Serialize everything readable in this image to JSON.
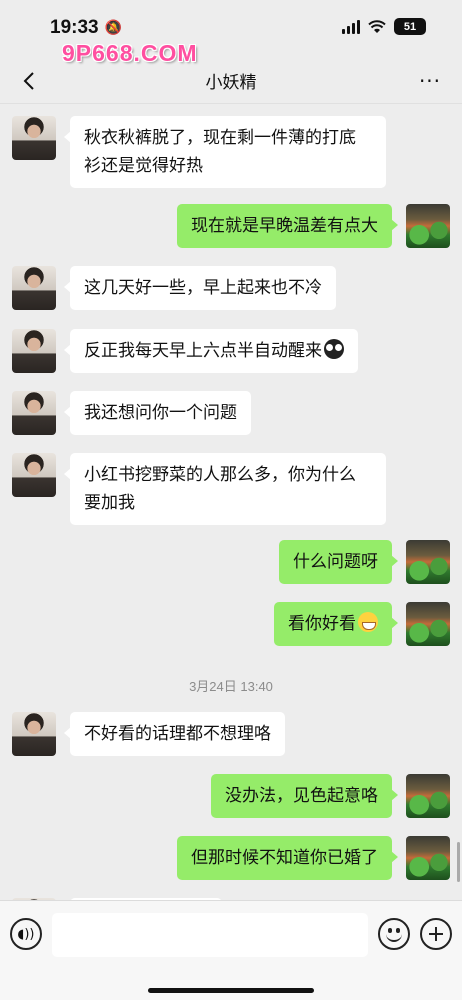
{
  "status_bar": {
    "time": "19:33",
    "battery": "51"
  },
  "watermark": {
    "logo": "9P668.COM"
  },
  "nav": {
    "title": "小妖精",
    "back_icon": "chevron-left-icon",
    "more_icon": "ellipsis-icon",
    "more_label": "···"
  },
  "messages": [
    {
      "side": "left",
      "text": "秋衣秋裤脱了，现在剩一件薄的打底衫还是觉得好热"
    },
    {
      "side": "right",
      "text": "现在就是早晚温差有点大"
    },
    {
      "side": "left",
      "text": "这几天好一些，早上起来也不冷"
    },
    {
      "side": "left",
      "text": "反正我每天早上六点半自动醒来",
      "emoji": "owl-emoji"
    },
    {
      "side": "left",
      "text": "我还想问你一个问题"
    },
    {
      "side": "left",
      "text": "小红书挖野菜的人那么多，你为什么要加我"
    },
    {
      "side": "right",
      "text": "什么问题呀"
    },
    {
      "side": "right",
      "text": "看你好看",
      "emoji": "grin-emoji"
    },
    {
      "side": "left",
      "text": "不好看的话理都不想理咯"
    },
    {
      "side": "right",
      "text": "没办法，见色起意咯"
    },
    {
      "side": "right",
      "text": "但那时候不知道你已婚了"
    }
  ],
  "timestamp": "3月24日 13:40",
  "input_bar": {
    "voice_icon": "voice-icon",
    "emoji_icon": "smiley-icon",
    "plus_icon": "plus-icon"
  },
  "colors": {
    "background": "#ededed",
    "sent_bubble": "#95ec69",
    "received_bubble": "#ffffff",
    "watermark": "#ff4fa0"
  }
}
